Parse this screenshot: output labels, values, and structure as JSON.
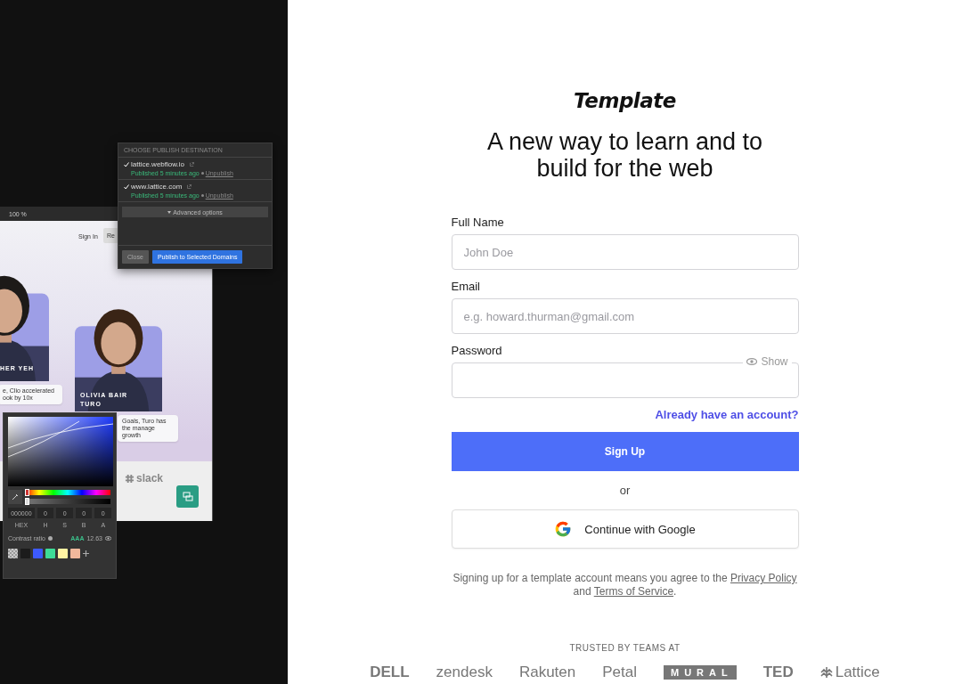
{
  "showcase": {
    "site_window": {
      "zoom": "100 %",
      "nav": [
        {
          "label": "Sign In",
          "kind": "link"
        },
        {
          "label": "Re",
          "kind": "button"
        }
      ],
      "cards": [
        {
          "name": "HER YEH",
          "quote": "e, Clio accelerated ook by 10x"
        },
        {
          "name": "OLIVIA BAIR",
          "company": "TURO",
          "quote": "Goals, Turo has the manage growth"
        }
      ],
      "footer_logo": "slack"
    },
    "publish": {
      "heading": "CHOOSE PUBLISH DESTINATION",
      "domains": [
        {
          "name": "lattice.webflow.io",
          "checked": true,
          "status": "Published 5 minutes ago",
          "action": "Unpublish"
        },
        {
          "name": "www.lattice.com",
          "checked": true,
          "status": "Published 5 minutes ago",
          "action": "Unpublish"
        }
      ],
      "advanced": "Advanced options",
      "close": "Close",
      "submit": "Publish to Selected Domains"
    },
    "color_picker": {
      "hue": {
        "level": 0
      },
      "alpha": {
        "level": 0
      },
      "hex": "000000",
      "values": [
        "0",
        "0",
        "0",
        "0"
      ],
      "labels": [
        "HEX",
        "H",
        "S",
        "B",
        "A"
      ],
      "contrast_label": "Contrast ratio",
      "rating": "AAA",
      "ratio": "12.63",
      "swatches": [
        {
          "kind": "transparent"
        },
        {
          "kind": "solid",
          "color": "#1c1c1c"
        },
        {
          "kind": "solid",
          "color": "#3d5afe"
        },
        {
          "kind": "solid",
          "color": "#3ddc97"
        },
        {
          "kind": "solid",
          "color": "#fff4a3"
        },
        {
          "kind": "solid",
          "color": "#f0b89c"
        }
      ]
    }
  },
  "brand": "Template",
  "headline": "A new way to learn and to build for the web",
  "form": {
    "fields": [
      {
        "kind": "text",
        "label": "Full Name",
        "placeholder": "John Doe"
      },
      {
        "kind": "text",
        "label": "Email",
        "placeholder": "e.g. howard.thurman@gmail.com"
      },
      {
        "kind": "password",
        "label": "Password",
        "toggle": "Show"
      }
    ],
    "signin_link": "Already have an account?",
    "submit": "Sign Up",
    "divider": "or",
    "google_button": "Continue with Google",
    "terms": {
      "before": "Signing up for a template account means you agree to the",
      "privacy": "Privacy Policy",
      "middle": "and",
      "tos": "Terms of Service",
      "after": "."
    }
  },
  "trusted": {
    "heading": "TRUSTED BY TEAMS AT",
    "logos": [
      {
        "kind": "bold",
        "label": "DELL"
      },
      {
        "kind": "light",
        "label": "zendesk"
      },
      {
        "kind": "plain",
        "label": "Rakuten"
      },
      {
        "kind": "light",
        "label": "Petal"
      },
      {
        "kind": "boxed",
        "label": "MURAL"
      },
      {
        "kind": "bold",
        "label": "TED"
      },
      {
        "kind": "mark",
        "label": "Lattice"
      }
    ]
  }
}
